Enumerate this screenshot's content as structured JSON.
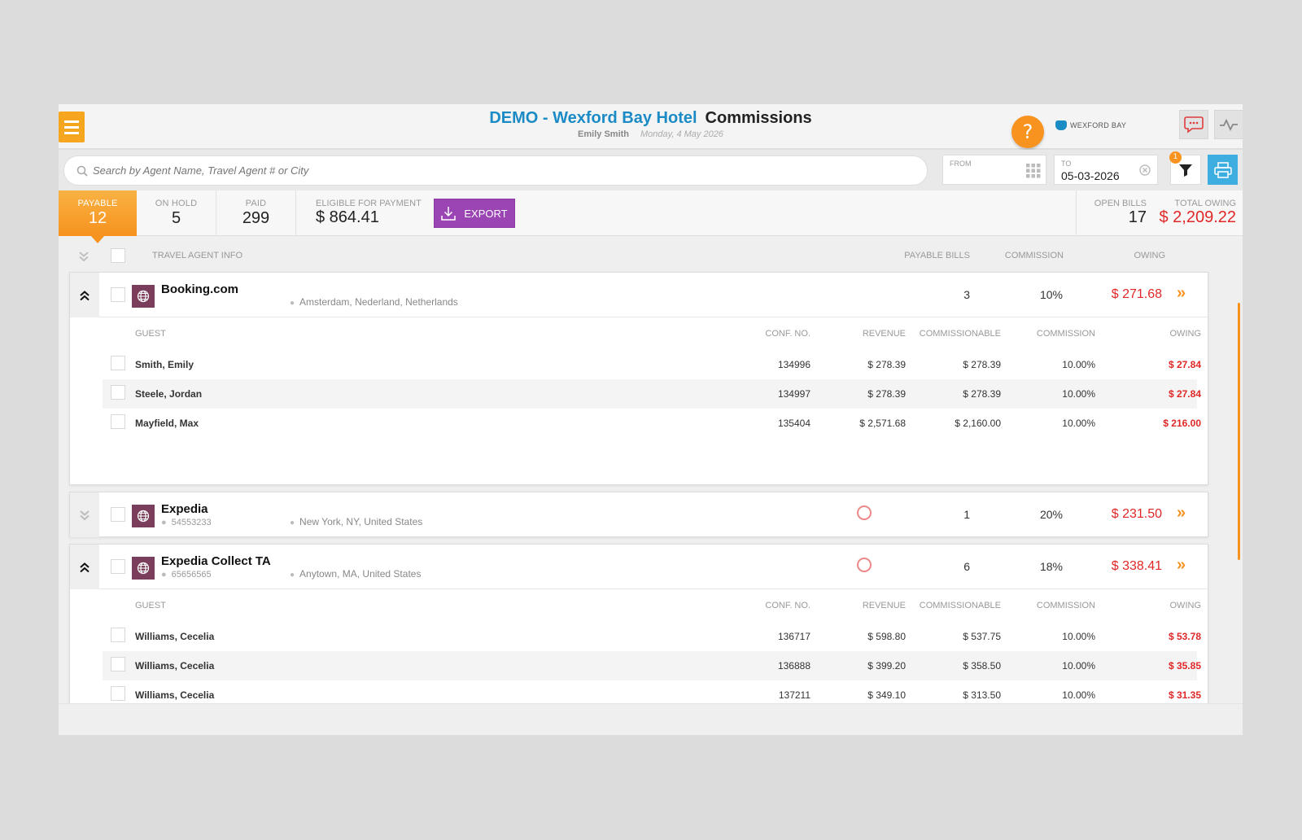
{
  "header": {
    "hotel_title": "DEMO - Wexford Bay Hotel",
    "section_title": "Commissions",
    "user": "Emily Smith",
    "date": "Monday, 4 May 2026",
    "brand": "WEXFORD BAY",
    "help": "?"
  },
  "search": {
    "placeholder": "Search by Agent Name, Travel Agent # or City",
    "from_label": "FROM",
    "from_value": "",
    "to_label": "TO",
    "to_value": "05-03-2026",
    "filter_badge": "1"
  },
  "stats": {
    "payable_label": "PAYABLE",
    "payable": "12",
    "onhold_label": "ON HOLD",
    "onhold": "5",
    "paid_label": "PAID",
    "paid": "299",
    "eligible_label": "ELIGIBLE FOR PAYMENT",
    "eligible": "$ 864.41",
    "export_label": "EXPORT",
    "open_bills_label": "OPEN BILLS",
    "open_bills": "17",
    "total_owing_label": "TOTAL OWING",
    "total_owing": "$ 2,209.22"
  },
  "columns": {
    "agent_info": "TRAVEL AGENT INFO",
    "payable_bills": "PAYABLE BILLS",
    "commission": "COMMISSION",
    "owing": "OWING"
  },
  "detail_columns": {
    "guest": "GUEST",
    "conf": "CONF. NO.",
    "revenue": "REVENUE",
    "commissionable": "COMMISSIONABLE",
    "commission": "COMMISSION",
    "owing": "OWING"
  },
  "agents": [
    {
      "name": "Booking.com",
      "id": "",
      "location": "Amsterdam, Nederland, Netherlands",
      "payable_bills": "3",
      "commission": "10%",
      "owing": "$ 271.68",
      "rows": [
        {
          "guest": "Smith, Emily",
          "conf": "134996",
          "revenue": "$ 278.39",
          "commissionable": "$ 278.39",
          "commission": "10.00%",
          "owing": "$ 27.84"
        },
        {
          "guest": "Steele, Jordan",
          "conf": "134997",
          "revenue": "$ 278.39",
          "commissionable": "$ 278.39",
          "commission": "10.00%",
          "owing": "$ 27.84"
        },
        {
          "guest": "Mayfield, Max",
          "conf": "135404",
          "revenue": "$ 2,571.68",
          "commissionable": "$ 2,160.00",
          "commission": "10.00%",
          "owing": "$ 216.00"
        }
      ]
    },
    {
      "name": "Expedia",
      "id": "54553233",
      "location": "New York, NY, United States",
      "payable_bills": "1",
      "commission": "20%",
      "owing": "$ 231.50",
      "rows": []
    },
    {
      "name": "Expedia Collect TA",
      "id": "65656565",
      "location": "Anytown, MA, United States",
      "payable_bills": "6",
      "commission": "18%",
      "owing": "$ 338.41",
      "rows": [
        {
          "guest": "Williams, Cecelia",
          "conf": "136717",
          "revenue": "$ 598.80",
          "commissionable": "$ 537.75",
          "commission": "10.00%",
          "owing": "$ 53.78"
        },
        {
          "guest": "Williams, Cecelia",
          "conf": "136888",
          "revenue": "$ 399.20",
          "commissionable": "$ 358.50",
          "commission": "10.00%",
          "owing": "$ 35.85"
        },
        {
          "guest": "Williams, Cecelia",
          "conf": "137211",
          "revenue": "$ 349.10",
          "commissionable": "$ 313.50",
          "commission": "10.00%",
          "owing": "$ 31.35"
        }
      ]
    }
  ],
  "colors": {
    "accent": "#f6921e",
    "title_blue": "#1b8bc6",
    "export_purple": "#9b44b3",
    "owing_red": "#e02727",
    "agent_icon": "#7b3d5c"
  },
  "icons": [
    "menu-icon",
    "help-icon",
    "chat-icon",
    "activity-icon",
    "search-icon",
    "calendar-grid-icon",
    "clear-icon",
    "filter-icon",
    "print-icon",
    "download-icon",
    "collapse-icon",
    "expand-icon",
    "globe-icon",
    "location-pin-icon",
    "double-chevron-right-icon",
    "hold-icon"
  ]
}
